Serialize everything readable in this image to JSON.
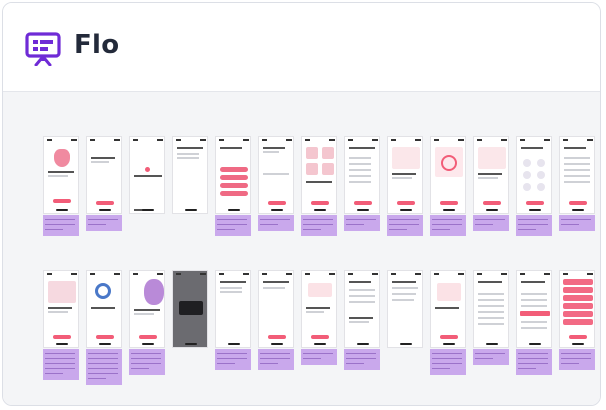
{
  "app": {
    "name": "Flo",
    "icon": "presentation-board-icon",
    "accent": "#6f2bd6"
  },
  "colors": {
    "primary_button": "#f25d78",
    "note_purple": "#c9a8ec",
    "canvas_bg": "#f4f5f7"
  },
  "rows": [
    {
      "screens": [
        {
          "kind": "privacy-shield",
          "note_lines": 3
        },
        {
          "kind": "welcome-text",
          "note_lines": 2
        },
        {
          "kind": "splash-logo",
          "note_lines": 0
        },
        {
          "kind": "question-input",
          "note_lines": 0
        },
        {
          "kind": "goal-options",
          "note_lines": 3
        },
        {
          "kind": "name-input",
          "note_lines": 2
        },
        {
          "kind": "photo-grid",
          "note_lines": 3
        },
        {
          "kind": "checklist",
          "note_lines": 2
        },
        {
          "kind": "illustration-card",
          "note_lines": 3
        },
        {
          "kind": "cycle-chart",
          "note_lines": 3
        },
        {
          "kind": "illustration-card",
          "note_lines": 2
        },
        {
          "kind": "icon-grid",
          "note_lines": 3
        },
        {
          "kind": "list-options",
          "note_lines": 2
        }
      ]
    },
    {
      "screens": [
        {
          "kind": "illustration-grid",
          "note_lines": 5
        },
        {
          "kind": "magnifier",
          "note_lines": 6
        },
        {
          "kind": "woman-illustration",
          "note_lines": 4
        },
        {
          "kind": "dark-dialog",
          "note_lines": 0
        },
        {
          "kind": "question-input",
          "note_lines": 3
        },
        {
          "kind": "symptom-checklist",
          "note_lines": 3
        },
        {
          "kind": "pills-illustration",
          "note_lines": 2
        },
        {
          "kind": "form-fields",
          "note_lines": 3
        },
        {
          "kind": "text-options",
          "note_lines": 0
        },
        {
          "kind": "calendar-illustration",
          "note_lines": 4
        },
        {
          "kind": "picker-list",
          "note_lines": 2
        },
        {
          "kind": "picker-selected",
          "note_lines": 4
        },
        {
          "kind": "pink-list",
          "note_lines": 3
        }
      ]
    }
  ]
}
